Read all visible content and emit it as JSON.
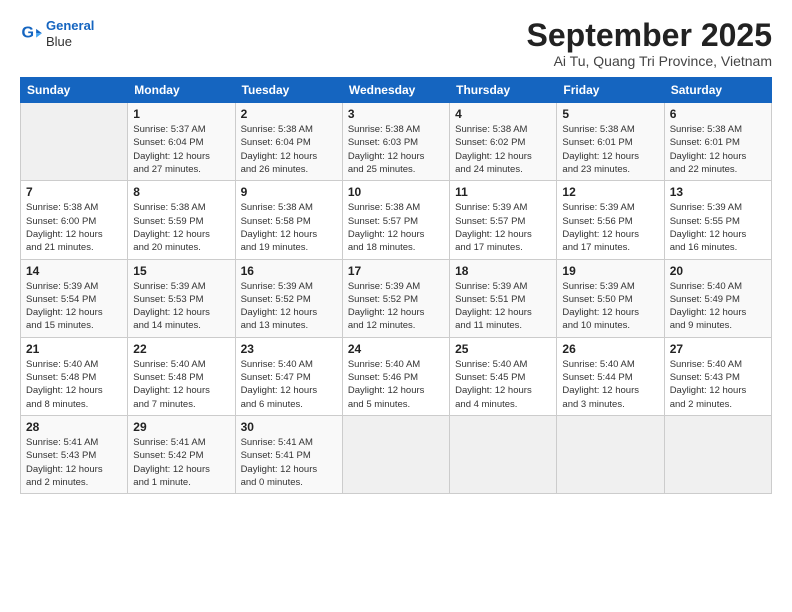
{
  "header": {
    "logo_line1": "General",
    "logo_line2": "Blue",
    "title": "September 2025",
    "subtitle": "Ai Tu, Quang Tri Province, Vietnam"
  },
  "weekdays": [
    "Sunday",
    "Monday",
    "Tuesday",
    "Wednesday",
    "Thursday",
    "Friday",
    "Saturday"
  ],
  "weeks": [
    [
      {
        "day": "",
        "info": ""
      },
      {
        "day": "1",
        "info": "Sunrise: 5:37 AM\nSunset: 6:04 PM\nDaylight: 12 hours\nand 27 minutes."
      },
      {
        "day": "2",
        "info": "Sunrise: 5:38 AM\nSunset: 6:04 PM\nDaylight: 12 hours\nand 26 minutes."
      },
      {
        "day": "3",
        "info": "Sunrise: 5:38 AM\nSunset: 6:03 PM\nDaylight: 12 hours\nand 25 minutes."
      },
      {
        "day": "4",
        "info": "Sunrise: 5:38 AM\nSunset: 6:02 PM\nDaylight: 12 hours\nand 24 minutes."
      },
      {
        "day": "5",
        "info": "Sunrise: 5:38 AM\nSunset: 6:01 PM\nDaylight: 12 hours\nand 23 minutes."
      },
      {
        "day": "6",
        "info": "Sunrise: 5:38 AM\nSunset: 6:01 PM\nDaylight: 12 hours\nand 22 minutes."
      }
    ],
    [
      {
        "day": "7",
        "info": "Sunrise: 5:38 AM\nSunset: 6:00 PM\nDaylight: 12 hours\nand 21 minutes."
      },
      {
        "day": "8",
        "info": "Sunrise: 5:38 AM\nSunset: 5:59 PM\nDaylight: 12 hours\nand 20 minutes."
      },
      {
        "day": "9",
        "info": "Sunrise: 5:38 AM\nSunset: 5:58 PM\nDaylight: 12 hours\nand 19 minutes."
      },
      {
        "day": "10",
        "info": "Sunrise: 5:38 AM\nSunset: 5:57 PM\nDaylight: 12 hours\nand 18 minutes."
      },
      {
        "day": "11",
        "info": "Sunrise: 5:39 AM\nSunset: 5:57 PM\nDaylight: 12 hours\nand 17 minutes."
      },
      {
        "day": "12",
        "info": "Sunrise: 5:39 AM\nSunset: 5:56 PM\nDaylight: 12 hours\nand 17 minutes."
      },
      {
        "day": "13",
        "info": "Sunrise: 5:39 AM\nSunset: 5:55 PM\nDaylight: 12 hours\nand 16 minutes."
      }
    ],
    [
      {
        "day": "14",
        "info": "Sunrise: 5:39 AM\nSunset: 5:54 PM\nDaylight: 12 hours\nand 15 minutes."
      },
      {
        "day": "15",
        "info": "Sunrise: 5:39 AM\nSunset: 5:53 PM\nDaylight: 12 hours\nand 14 minutes."
      },
      {
        "day": "16",
        "info": "Sunrise: 5:39 AM\nSunset: 5:52 PM\nDaylight: 12 hours\nand 13 minutes."
      },
      {
        "day": "17",
        "info": "Sunrise: 5:39 AM\nSunset: 5:52 PM\nDaylight: 12 hours\nand 12 minutes."
      },
      {
        "day": "18",
        "info": "Sunrise: 5:39 AM\nSunset: 5:51 PM\nDaylight: 12 hours\nand 11 minutes."
      },
      {
        "day": "19",
        "info": "Sunrise: 5:39 AM\nSunset: 5:50 PM\nDaylight: 12 hours\nand 10 minutes."
      },
      {
        "day": "20",
        "info": "Sunrise: 5:40 AM\nSunset: 5:49 PM\nDaylight: 12 hours\nand 9 minutes."
      }
    ],
    [
      {
        "day": "21",
        "info": "Sunrise: 5:40 AM\nSunset: 5:48 PM\nDaylight: 12 hours\nand 8 minutes."
      },
      {
        "day": "22",
        "info": "Sunrise: 5:40 AM\nSunset: 5:48 PM\nDaylight: 12 hours\nand 7 minutes."
      },
      {
        "day": "23",
        "info": "Sunrise: 5:40 AM\nSunset: 5:47 PM\nDaylight: 12 hours\nand 6 minutes."
      },
      {
        "day": "24",
        "info": "Sunrise: 5:40 AM\nSunset: 5:46 PM\nDaylight: 12 hours\nand 5 minutes."
      },
      {
        "day": "25",
        "info": "Sunrise: 5:40 AM\nSunset: 5:45 PM\nDaylight: 12 hours\nand 4 minutes."
      },
      {
        "day": "26",
        "info": "Sunrise: 5:40 AM\nSunset: 5:44 PM\nDaylight: 12 hours\nand 3 minutes."
      },
      {
        "day": "27",
        "info": "Sunrise: 5:40 AM\nSunset: 5:43 PM\nDaylight: 12 hours\nand 2 minutes."
      }
    ],
    [
      {
        "day": "28",
        "info": "Sunrise: 5:41 AM\nSunset: 5:43 PM\nDaylight: 12 hours\nand 2 minutes."
      },
      {
        "day": "29",
        "info": "Sunrise: 5:41 AM\nSunset: 5:42 PM\nDaylight: 12 hours\nand 1 minute."
      },
      {
        "day": "30",
        "info": "Sunrise: 5:41 AM\nSunset: 5:41 PM\nDaylight: 12 hours\nand 0 minutes."
      },
      {
        "day": "",
        "info": ""
      },
      {
        "day": "",
        "info": ""
      },
      {
        "day": "",
        "info": ""
      },
      {
        "day": "",
        "info": ""
      }
    ]
  ]
}
